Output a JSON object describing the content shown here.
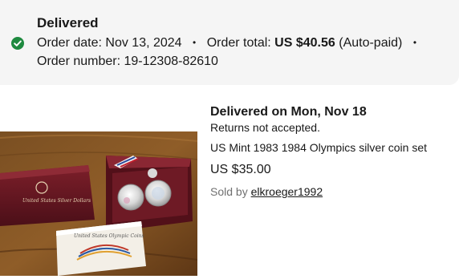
{
  "order_summary": {
    "status": "Delivered",
    "order_date_label": "Order date:",
    "order_date": "Nov 13, 2024",
    "separator": "•",
    "order_total_label": "Order total:",
    "order_total": "US $40.56",
    "payment_note": "(Auto-paid)",
    "order_number_label": "Order number:",
    "order_number": "19-12308-82610",
    "status_color": "#1e8a3f"
  },
  "item": {
    "delivery": "Delivered on Mon, Nov 18",
    "returns": "Returns not accepted.",
    "title": "US Mint 1983 1984 Olympics silver coin set",
    "price": "US $35.00",
    "sold_by_label": "Sold by",
    "seller": "elkroeger1992",
    "photo_box_text": "United States Silver Dollars",
    "photo_booklet_text": "United States Olympic Coins"
  },
  "icons": {
    "status": "check-circle-icon"
  }
}
